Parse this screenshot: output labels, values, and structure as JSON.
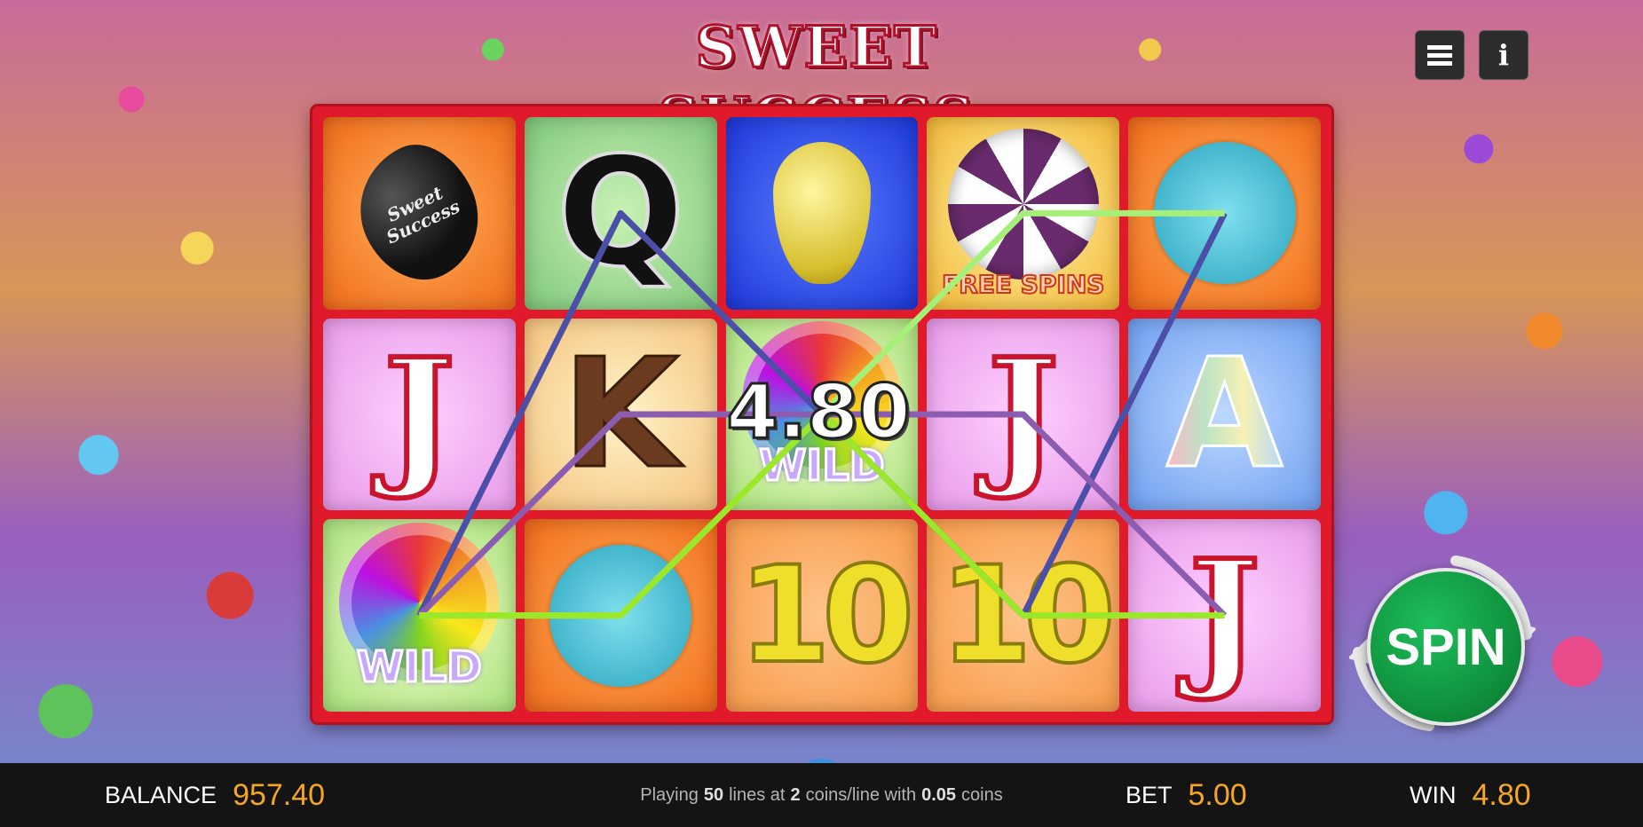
{
  "game": {
    "title": "SWEET SUCCESS",
    "win_display": "4.80"
  },
  "reels": {
    "rows": [
      [
        {
          "symbol": "Sweet Success",
          "icon": "jelly-bean-icon",
          "bg": "bg-orange"
        },
        {
          "symbol": "Q",
          "icon": "q-letter",
          "bg": "bg-green"
        },
        {
          "symbol": "",
          "icon": "pear-candy-icon",
          "bg": "bg-blue"
        },
        {
          "symbol": "FREE SPINS",
          "icon": "swirl-candy-icon",
          "bg": "bg-yellow"
        },
        {
          "symbol": "",
          "icon": "fuzzy-candy-icon",
          "bg": "bg-orange"
        }
      ],
      [
        {
          "symbol": "J",
          "icon": "j-letter",
          "bg": "bg-pink"
        },
        {
          "symbol": "K",
          "icon": "k-letter",
          "bg": "bg-cream"
        },
        {
          "symbol": "WILD",
          "icon": "wild-lollipop-icon",
          "bg": "bg-rainbow"
        },
        {
          "symbol": "J",
          "icon": "j-letter",
          "bg": "bg-pink"
        },
        {
          "symbol": "A",
          "icon": "a-letter",
          "bg": "bg-sky"
        }
      ],
      [
        {
          "symbol": "WILD",
          "icon": "wild-lollipop-icon",
          "bg": "bg-rainbow"
        },
        {
          "symbol": "",
          "icon": "fuzzy-candy-icon",
          "bg": "bg-orange"
        },
        {
          "symbol": "10",
          "icon": "ten-symbol",
          "bg": "bg-peach"
        },
        {
          "symbol": "10",
          "icon": "ten-symbol",
          "bg": "bg-peach"
        },
        {
          "symbol": "J",
          "icon": "j-letter",
          "bg": "bg-pink"
        }
      ]
    ],
    "paylines": [
      {
        "color": "#4b4fa8",
        "path": [
          [
            0,
            2
          ],
          [
            1,
            0
          ],
          [
            2,
            1
          ],
          [
            3,
            2
          ],
          [
            4,
            0
          ]
        ]
      },
      {
        "color": "#8c5cb0",
        "path": [
          [
            0,
            2
          ],
          [
            1,
            1
          ],
          [
            2,
            1
          ],
          [
            3,
            1
          ],
          [
            4,
            2
          ]
        ]
      },
      {
        "color": "#a6f07a",
        "path": [
          [
            0,
            2
          ],
          [
            1,
            2
          ],
          [
            2,
            1
          ],
          [
            3,
            0
          ],
          [
            4,
            0
          ]
        ]
      },
      {
        "color": "#9be82a",
        "path": [
          [
            0,
            2
          ],
          [
            1,
            2
          ],
          [
            2,
            1
          ],
          [
            3,
            2
          ],
          [
            4,
            2
          ]
        ]
      }
    ]
  },
  "controls": {
    "spin_label": "SPIN"
  },
  "bottom_bar": {
    "balance_label": "BALANCE",
    "balance_value": "957.40",
    "play_prefix": "Playing",
    "lines": "50",
    "lines_text": "lines at",
    "coins_per_line": "2",
    "coins_text": "coins/line with",
    "coin_value": "0.05",
    "coin_suffix": "coins",
    "bet_label": "BET",
    "bet_value": "5.00",
    "win_label": "WIN",
    "win_value": "4.80"
  }
}
